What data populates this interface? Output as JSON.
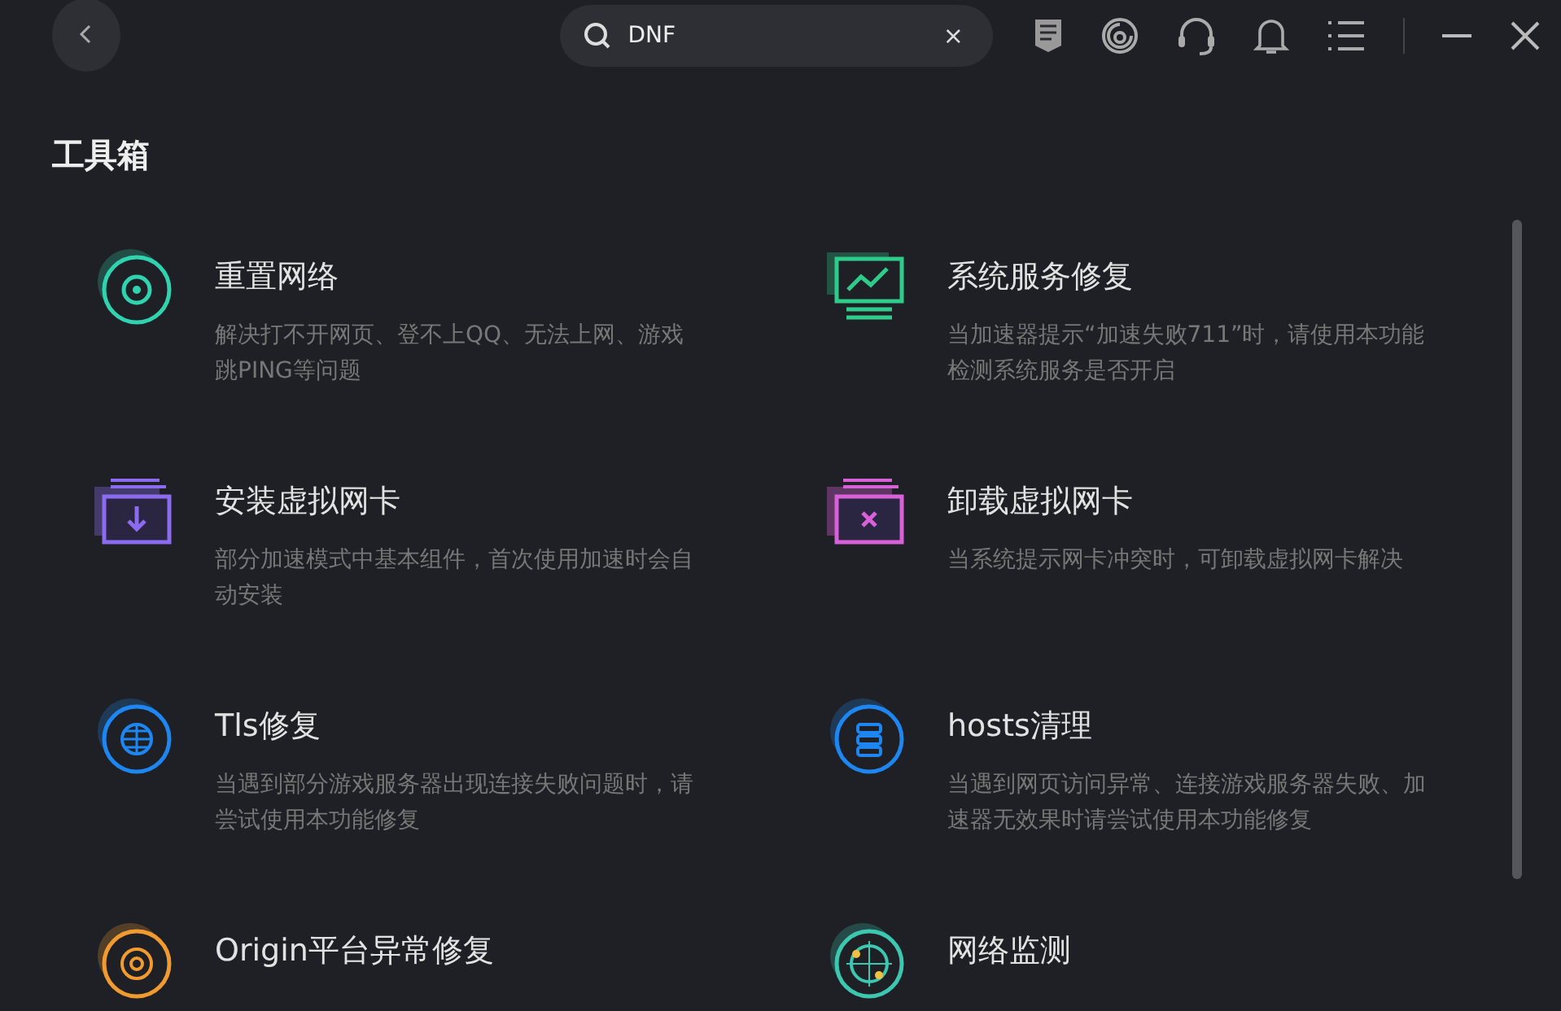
{
  "search": {
    "value": "DNF",
    "clear": "×"
  },
  "section_title": "工具箱",
  "tools": [
    {
      "kind": "reset",
      "title": "重置网络",
      "description": "解决打不开网页、登不上QQ、无法上网、游戏跳PING等问题"
    },
    {
      "kind": "service",
      "title": "系统服务修复",
      "description": "当加速器提示“加速失败711”时，请使用本功能检测系统服务是否开启"
    },
    {
      "kind": "install",
      "title": "安装虚拟网卡",
      "description": "部分加速模式中基本组件，首次使用加速时会自动安装"
    },
    {
      "kind": "uninstall",
      "title": "卸载虚拟网卡",
      "description": "当系统提示网卡冲突时，可卸载虚拟网卡解决"
    },
    {
      "kind": "tls",
      "title": "Tls修复",
      "description": "当遇到部分游戏服务器出现连接失败问题时，请尝试使用本功能修复"
    },
    {
      "kind": "hosts",
      "title": "hosts清理",
      "description": "当遇到网页访问异常、连接游戏服务器失败、加速器无效果时请尝试使用本功能修复"
    },
    {
      "kind": "origin",
      "title": "Origin平台异常修复"
    },
    {
      "kind": "monitor",
      "title": "网络监测"
    }
  ]
}
